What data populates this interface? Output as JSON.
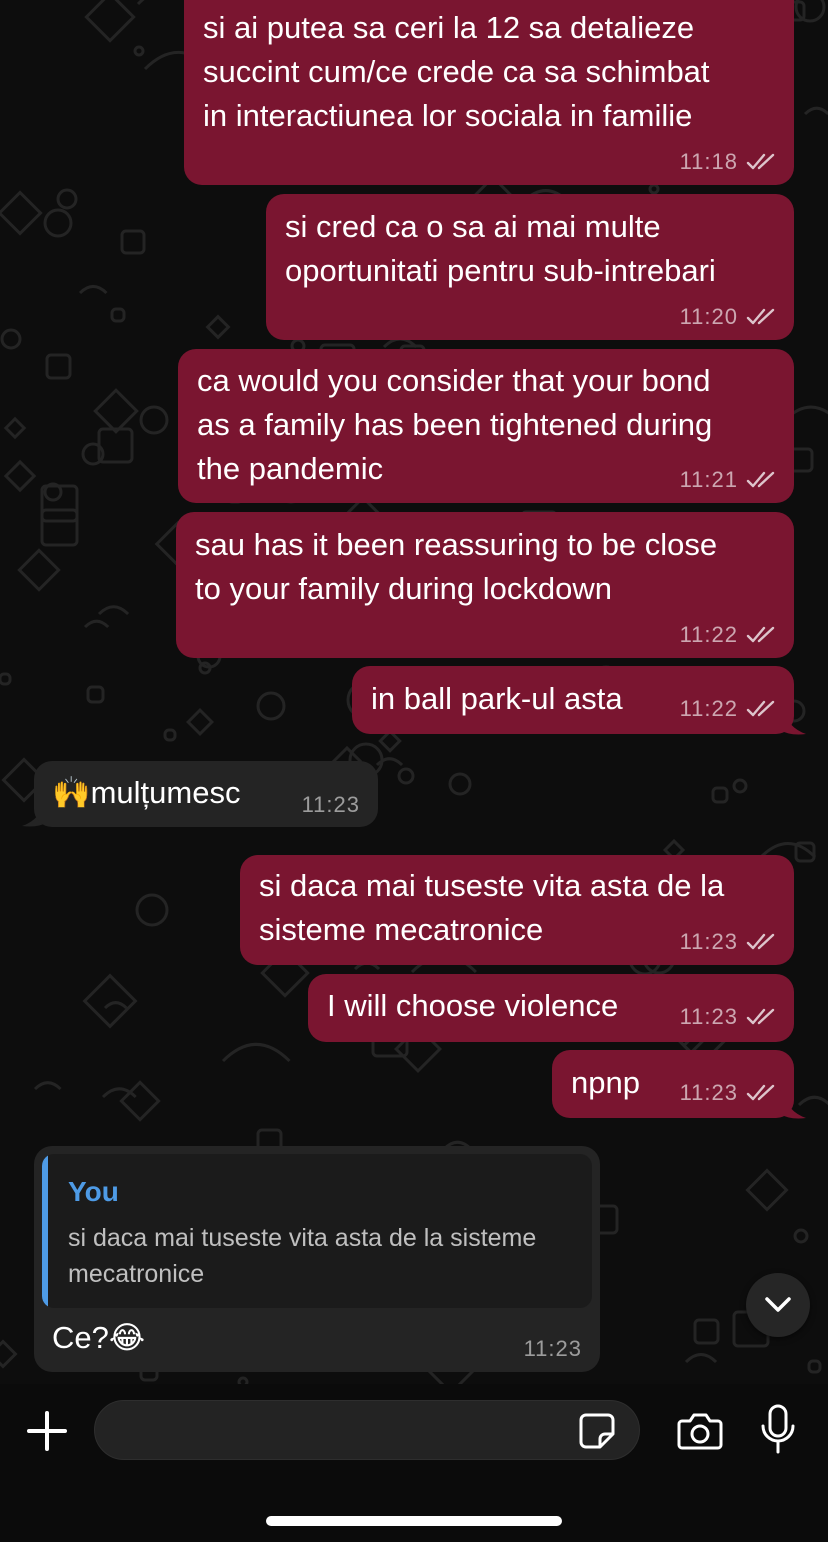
{
  "colors": {
    "outgoing_bubble": "#7a1530",
    "incoming_bubble": "#242424",
    "reply_accent": "#4e9be6",
    "background": "#0d0d0d"
  },
  "messages": [
    {
      "direction": "out",
      "lines": [
        "si ai putea sa ceri la 12 sa detalieze",
        "succint cum/ce crede ca sa schimbat",
        "in interactiunea lor sociala in familie"
      ],
      "time": "11:18",
      "status": "read-double-check-icon"
    },
    {
      "direction": "out",
      "lines": [
        "si cred ca o sa ai mai multe",
        "oportunitati pentru sub-intrebari"
      ],
      "time": "11:20",
      "status": "read-double-check-icon"
    },
    {
      "direction": "out",
      "lines": [
        "ca would you consider that your bond",
        "as a family has been tightened during",
        "the pandemic"
      ],
      "time": "11:21",
      "status": "read-double-check-icon"
    },
    {
      "direction": "out",
      "lines": [
        "sau has it been reassuring to be close",
        "to your family during lockdown"
      ],
      "time": "11:22",
      "status": "read-double-check-icon"
    },
    {
      "direction": "out",
      "lines": [
        "in ball park-ul asta"
      ],
      "time": "11:22",
      "status": "read-double-check-icon"
    },
    {
      "direction": "in",
      "lines": [
        "🙌mulțumesc"
      ],
      "time": "11:23"
    },
    {
      "direction": "out",
      "lines": [
        "si daca mai tuseste vita asta de la",
        "sisteme mecatronice"
      ],
      "time": "11:23",
      "status": "read-double-check-icon"
    },
    {
      "direction": "out",
      "lines": [
        "I will choose violence"
      ],
      "time": "11:23",
      "status": "read-double-check-icon"
    },
    {
      "direction": "out",
      "lines": [
        "npnp"
      ],
      "time": "11:23",
      "status": "read-double-check-icon"
    },
    {
      "direction": "in",
      "reply_to": {
        "author": "You",
        "text": "si daca mai tuseste vita asta de la sisteme mecatronice"
      },
      "lines": [
        "Ce?😂"
      ],
      "time": "11:23"
    }
  ],
  "composer": {
    "placeholder": "",
    "icons": [
      "plus-icon",
      "sticker-icon",
      "camera-icon",
      "microphone-icon"
    ]
  },
  "scroll_button_icon": "chevron-down-icon"
}
